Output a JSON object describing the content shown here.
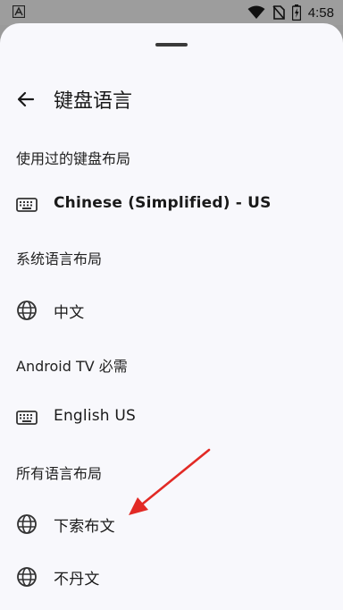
{
  "status": {
    "time": "4:58"
  },
  "header": {
    "title": "键盘语言"
  },
  "sections": [
    {
      "title": "使用过的键盘布局"
    },
    {
      "title": "系统语言布局"
    },
    {
      "title": "Android TV 必需"
    },
    {
      "title": "所有语言布局"
    }
  ],
  "rows": [
    {
      "label": "Chinese (Simplified) - US",
      "icon": "keyboard-icon"
    },
    {
      "label": "中文",
      "icon": "globe-icon"
    },
    {
      "label": "English US",
      "icon": "keyboard-icon"
    },
    {
      "label": "下索布文",
      "icon": "globe-icon"
    },
    {
      "label": "不丹文",
      "icon": "globe-icon"
    }
  ],
  "colors": {
    "sheet": "#f8f8fc",
    "scrim": "#9a9a9a",
    "arrow": "#e22a25"
  }
}
